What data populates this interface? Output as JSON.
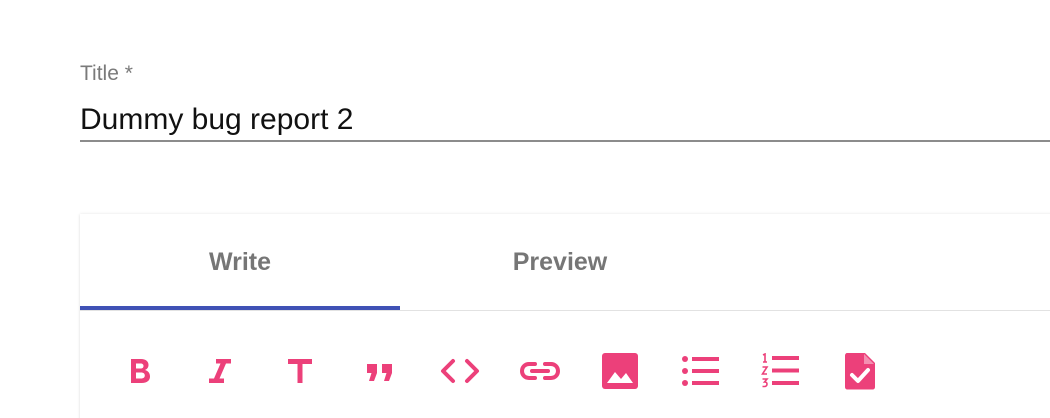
{
  "title_field": {
    "label": "Title *",
    "value": "Dummy bug report 2"
  },
  "editor": {
    "tabs": [
      {
        "label": "Write",
        "active": true
      },
      {
        "label": "Preview",
        "active": false
      }
    ],
    "accent_color": "#3f51b5",
    "icon_color": "#ec407a",
    "toolbar": [
      {
        "icon": "bold-icon"
      },
      {
        "icon": "italic-icon"
      },
      {
        "icon": "header-icon"
      },
      {
        "icon": "quote-icon"
      },
      {
        "icon": "code-icon"
      },
      {
        "icon": "link-icon"
      },
      {
        "icon": "image-icon"
      },
      {
        "icon": "bulleted-list-icon"
      },
      {
        "icon": "numbered-list-icon"
      },
      {
        "icon": "task-list-icon"
      }
    ]
  }
}
